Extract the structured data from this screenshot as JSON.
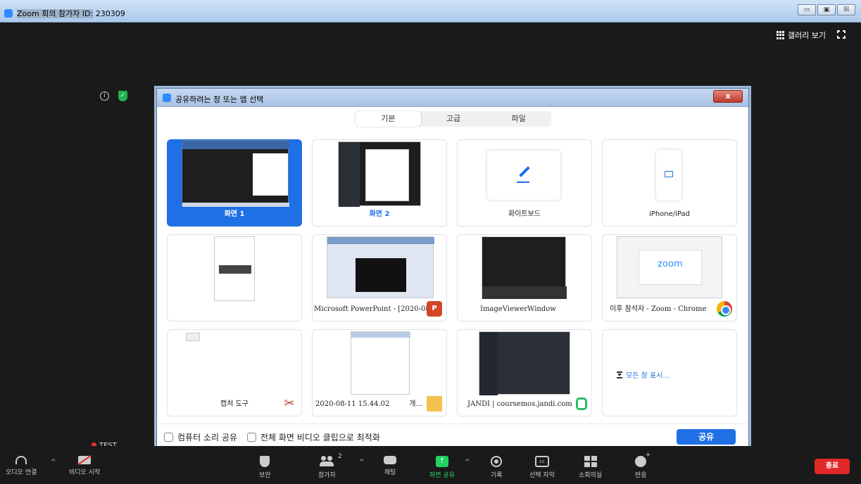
{
  "window": {
    "title_prefix": "Zoom 회의 참가자 ID:",
    "meeting_id": "230309",
    "btn_min": "▭",
    "btn_max": "▣",
    "btn_close": "☒"
  },
  "top_right": {
    "gallery_view": "갤러리 보기"
  },
  "dialog": {
    "title": "공유하려는 창 또는 앱 선택",
    "close": "x",
    "tabs": [
      "기본",
      "고급",
      "파일"
    ],
    "cards": [
      {
        "label": "화면 1",
        "selected": true
      },
      {
        "label": "화면 2"
      },
      {
        "label": "화이트보드"
      },
      {
        "label": "iPhone/iPad"
      },
      {
        "label": ""
      },
      {
        "label": "Microsoft PowerPoint - [2020-08-..."
      },
      {
        "label": "ImageViewerWindow"
      },
      {
        "label": "이후 참석자 - Zoom - Chrome"
      },
      {
        "label": "캡처 도구"
      },
      {
        "label": "2020-08-11 15.44.02"
      },
      {
        "label": "JANDI | coursemos.jandi.com"
      },
      {
        "label": "모든 창 표시..."
      }
    ],
    "folder_suffix": "개...",
    "ppt_badge": "P",
    "thumb_zoom_text": "zoom",
    "checkbox_computer_sound": "컴퓨터 소리 공유",
    "checkbox_optimize_video": "전체 화면 비디오 클립으로 최적화",
    "share_button": "공유"
  },
  "test_label": "TEST",
  "toolbar": {
    "items": [
      {
        "label": "오디오 연결",
        "icon": "headphone-icon"
      },
      {
        "label": "비디오 시작",
        "icon": "video-off-icon"
      },
      {
        "label": "보안",
        "icon": "shield-icon"
      },
      {
        "label": "참가자",
        "icon": "participants-icon",
        "count": "2"
      },
      {
        "label": "채팅",
        "icon": "chat-icon"
      },
      {
        "label": "화면 공유",
        "icon": "share-screen-icon"
      },
      {
        "label": "기록",
        "icon": "record-icon"
      },
      {
        "label": "선택 자막",
        "icon": "cc-icon"
      },
      {
        "label": "소회의실",
        "icon": "breakout-icon"
      },
      {
        "label": "반응",
        "icon": "reaction-icon"
      }
    ],
    "end": "종료",
    "cc_text": "cc",
    "share_arrow": "↑"
  },
  "colors": {
    "accent": "#1f6fe5",
    "share_green": "#23d160",
    "end_red": "#e02828"
  }
}
